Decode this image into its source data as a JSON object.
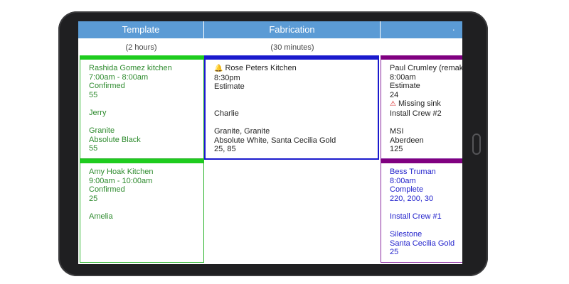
{
  "columns": [
    {
      "title": "Template",
      "duration": "(2 hours)"
    },
    {
      "title": "Fabrication",
      "duration": "(30 minutes)"
    },
    {
      "title": "·",
      "duration": ""
    }
  ],
  "cards": {
    "template_1": {
      "name": "Rashida Gomez kitchen",
      "time": "7:00am - 8:00am",
      "status": "Confirmed",
      "number": "55",
      "person": "Jerry",
      "material": "Granite",
      "color": "Absolute Black",
      "sqft": "55"
    },
    "template_2": {
      "name": "Amy Hoak Kitchen",
      "time": "9:00am - 10:00am",
      "status": "Confirmed",
      "number": "25",
      "person": "Amelia"
    },
    "fabrication_1": {
      "icon": "bell-icon",
      "name": "Rose Peters Kitchen",
      "time": "8:30pm",
      "status": "Estimate",
      "person": "Charlie",
      "material": "Granite, Granite",
      "color": "Absolute White, Santa Cecilia Gold",
      "sqft": "25, 85"
    },
    "third_1": {
      "name": "Paul Crumley (remak",
      "time": "8:00am",
      "status": "Estimate",
      "number": "24",
      "warning_icon": "warning-icon",
      "warning": "Missing sink",
      "crew": "Install Crew #2",
      "supplier": "MSI",
      "color": "Aberdeen",
      "sqft": "125"
    },
    "third_2": {
      "name": "Bess Truman",
      "time": "8:00am",
      "status": "Complete",
      "numbers": "220, 200, 30",
      "crew": "Install Crew #1",
      "material": "Silestone",
      "color": "Santa Cecilia Gold",
      "sqft": "25"
    }
  },
  "colors": {
    "header": "#5b9bd5",
    "green": "#1ecc1e",
    "blue": "#1a1acd",
    "purple": "#800080"
  }
}
